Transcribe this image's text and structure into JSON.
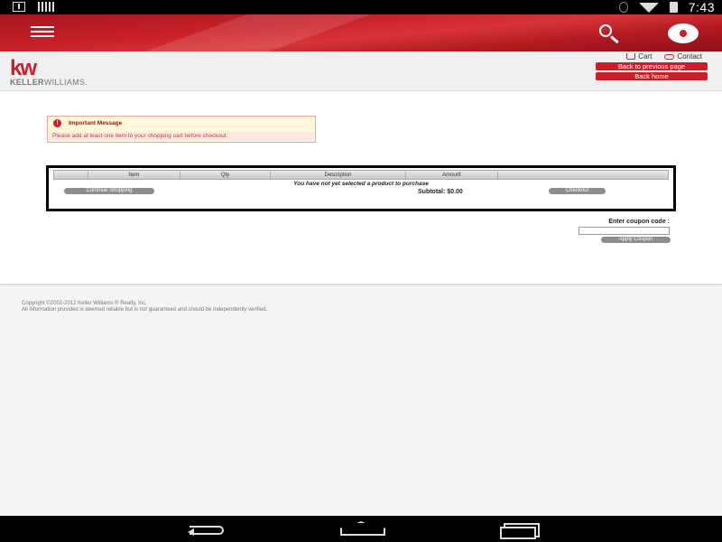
{
  "status_bar": {
    "time": "7:43",
    "icons": [
      "download-icon",
      "barcode-icon",
      "bluetooth-icon",
      "wifi-icon",
      "battery-icon"
    ]
  },
  "header": {
    "menu_icon": "hamburger-icon",
    "search_icon": "search-icon",
    "browser_icon": "chrome-icon",
    "brand_color": "#c8202a"
  },
  "logo": {
    "mark": "kw",
    "name_part1": "KELLER",
    "name_part2": "WILLIAMS."
  },
  "utility_links": {
    "cart": "Cart",
    "contact": "Contact"
  },
  "buttons": {
    "back_previous": "Back to previous page",
    "back_home": "Back home"
  },
  "alert": {
    "title": "Important Message",
    "message": "Please add at least one item to your shopping cart before checkout."
  },
  "cart": {
    "columns": [
      "",
      "Item",
      "Qty",
      "Description",
      "Amount"
    ],
    "empty_message": "You have not yet selected a product to purchase",
    "continue_label": "Continue Shopping",
    "subtotal_label": "Subtotal:",
    "subtotal_value": "$0.00",
    "checkout_label": "Checkout"
  },
  "coupon": {
    "label": "Enter coupon code :",
    "value": "",
    "apply_label": "Apply Coupon"
  },
  "footer": {
    "copyright": "Copyright ©2002-2012 Keller Williams ® Realty, Inc.",
    "disclaimer": "All information provided is deemed reliable but is not guaranteed and should be independently verified."
  }
}
